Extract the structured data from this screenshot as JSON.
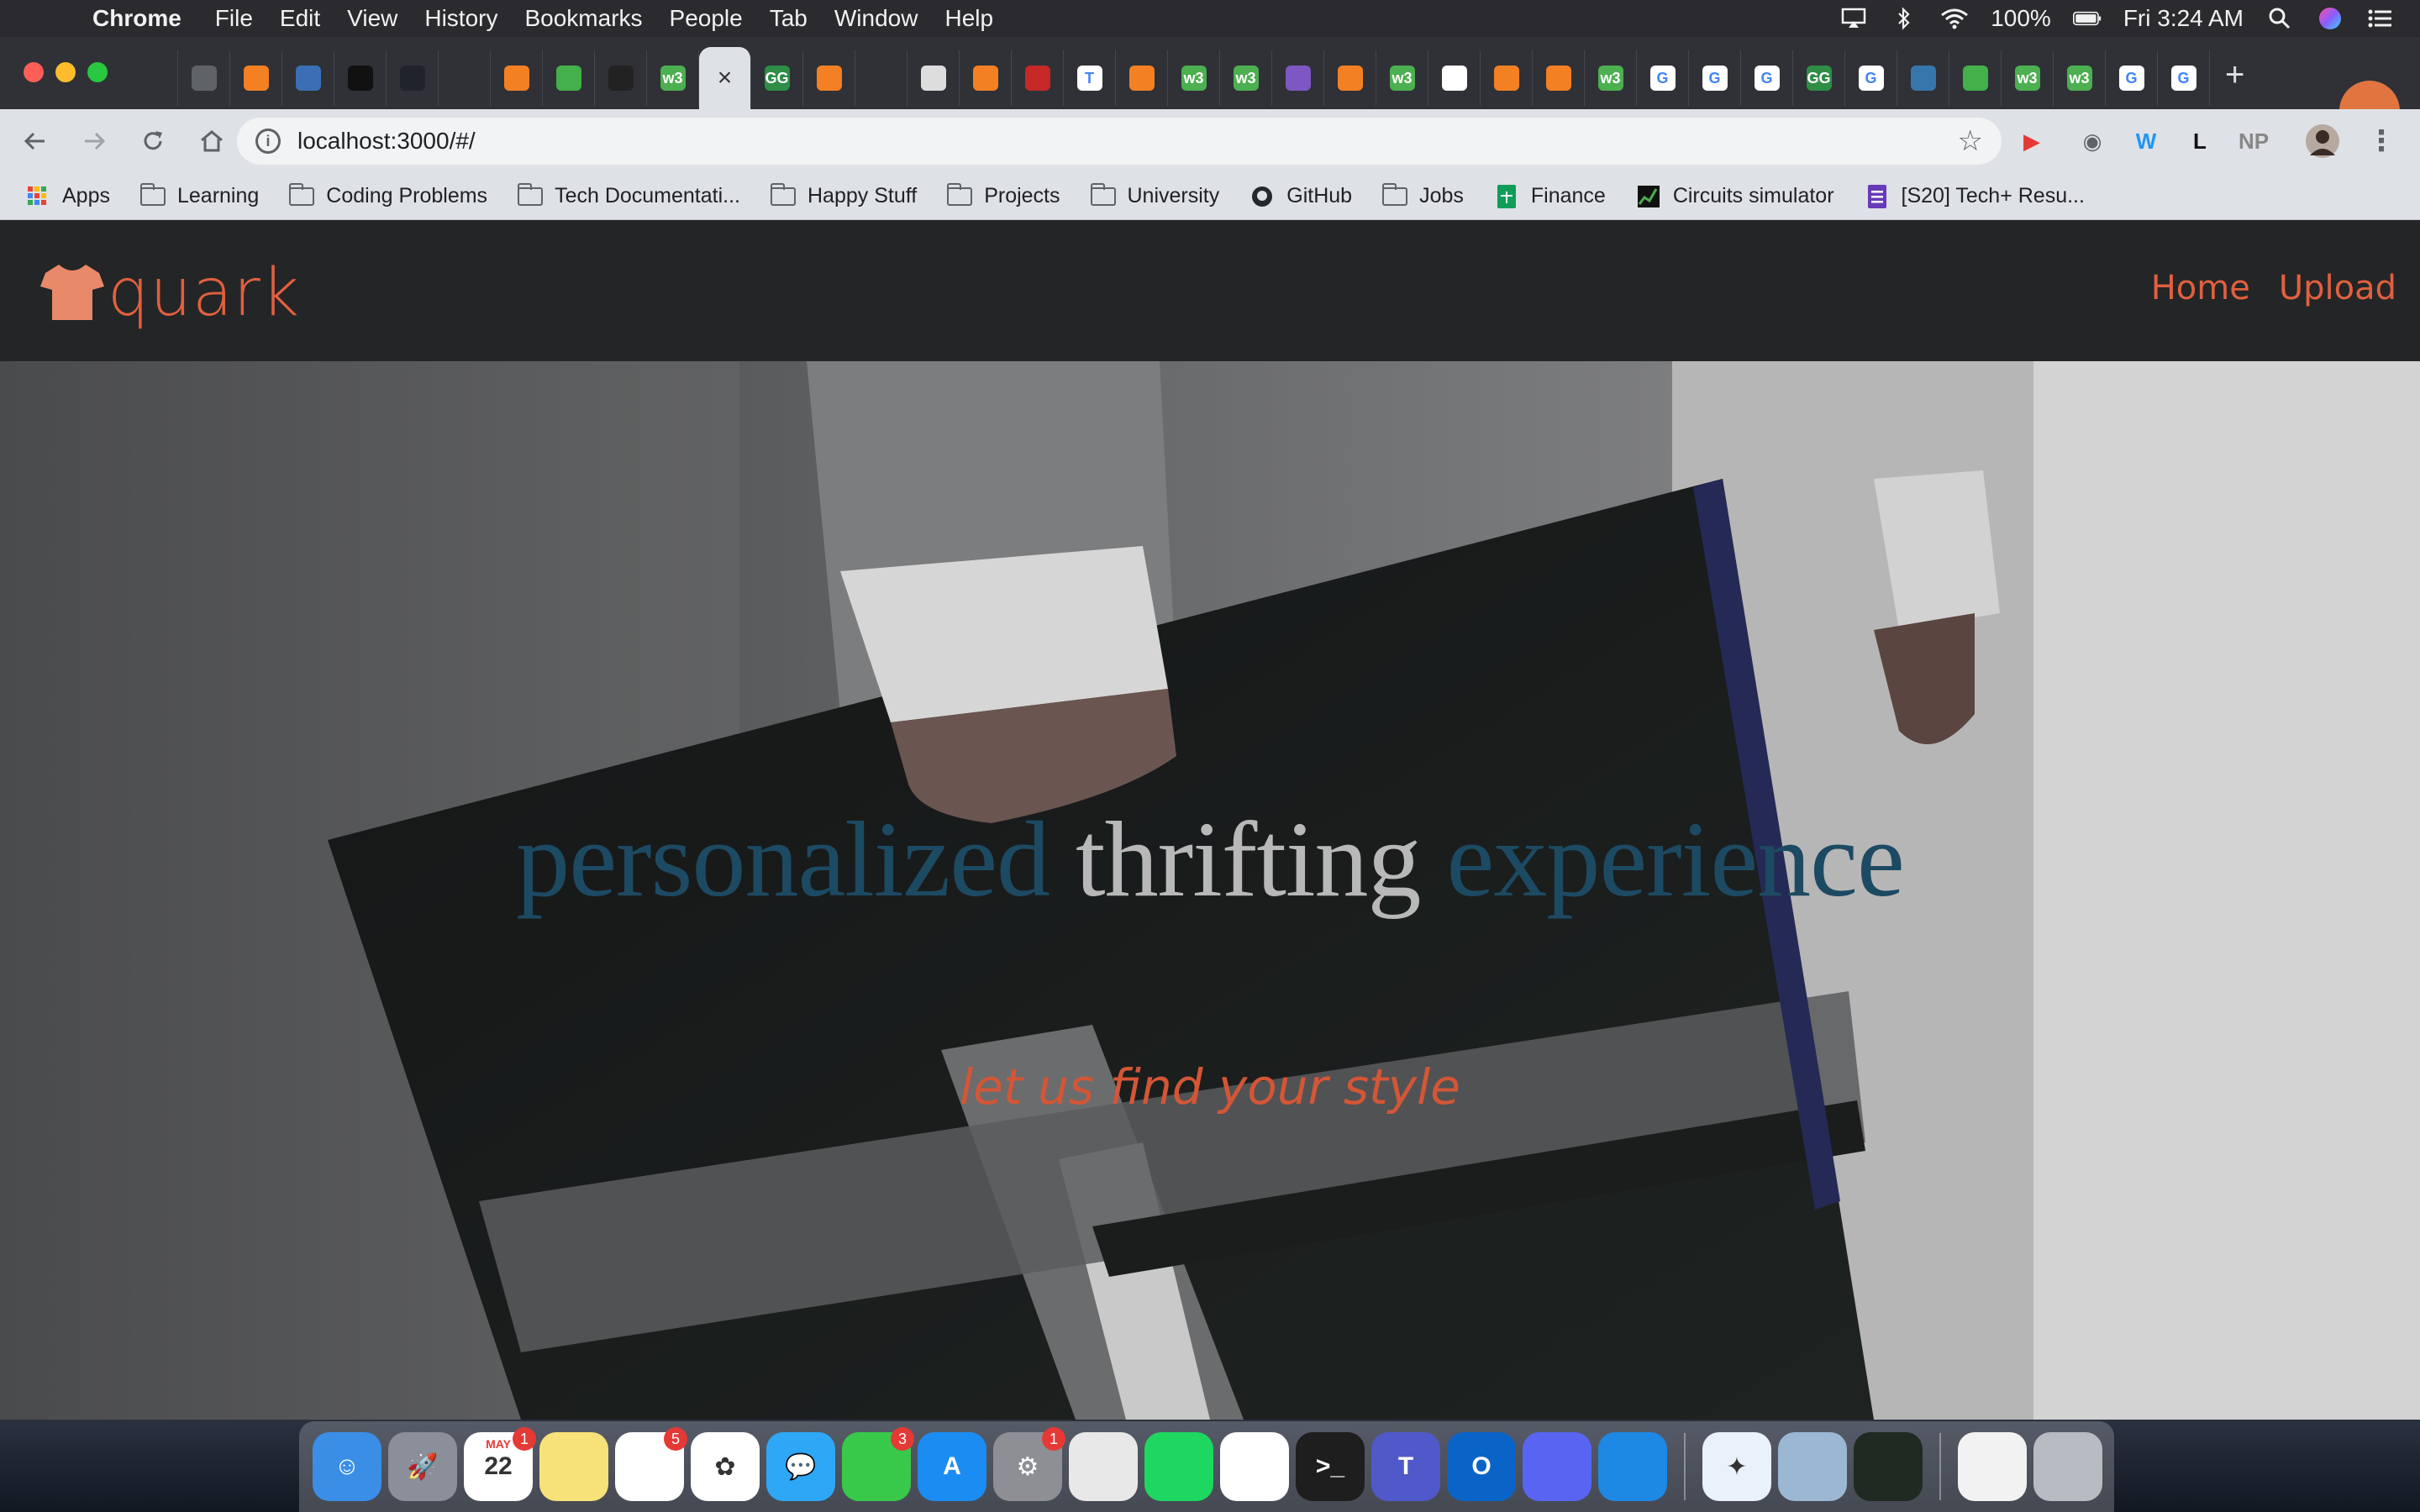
{
  "menubar": {
    "app_name": "Chrome",
    "menus": [
      "File",
      "Edit",
      "View",
      "History",
      "Bookmarks",
      "People",
      "Tab",
      "Window",
      "Help"
    ],
    "battery": "100%",
    "clock": "Fri 3:24 AM"
  },
  "tabs": [
    {
      "icon": "github-icon",
      "color": "#2f3136",
      "glyph": ""
    },
    {
      "icon": "globe-icon",
      "color": "#5f6368",
      "glyph": ""
    },
    {
      "icon": "stackoverflow-icon",
      "color": "#f48024",
      "glyph": ""
    },
    {
      "icon": "mathworks-icon",
      "color": "#3b6fb5",
      "glyph": ""
    },
    {
      "icon": "dots-icon",
      "color": "#111111",
      "glyph": ""
    },
    {
      "icon": "react-icon",
      "color": "#20232a",
      "glyph": ""
    },
    {
      "icon": "github-icon",
      "color": "#2f3136",
      "glyph": ""
    },
    {
      "icon": "stackoverflow-icon",
      "color": "#f48024",
      "glyph": ""
    },
    {
      "icon": "anaconda-icon",
      "color": "#43b049",
      "glyph": ""
    },
    {
      "icon": "s-icon",
      "color": "#222222",
      "glyph": ""
    },
    {
      "icon": "w3schools-icon",
      "color": "#4caf50",
      "glyph": "w3"
    },
    {
      "icon": "close-icon",
      "active": true,
      "glyph": "×"
    },
    {
      "icon": "geeksforgeeks-icon",
      "color": "#2f8d46",
      "glyph": "GG"
    },
    {
      "icon": "stackoverflow-icon",
      "color": "#f48024",
      "glyph": ""
    },
    {
      "icon": "github-icon",
      "color": "#2f3136",
      "glyph": ""
    },
    {
      "icon": "diamond-icon",
      "color": "#dddddd",
      "glyph": ""
    },
    {
      "icon": "stackoverflow-icon",
      "color": "#f48024",
      "glyph": ""
    },
    {
      "icon": "ball-icon",
      "color": "#c62828",
      "glyph": ""
    },
    {
      "icon": "t-icon",
      "color": "#ffffff",
      "glyph": "T"
    },
    {
      "icon": "stackoverflow-icon",
      "color": "#f48024",
      "glyph": ""
    },
    {
      "icon": "w3schools-icon",
      "color": "#4caf50",
      "glyph": "w3"
    },
    {
      "icon": "w3schools-icon",
      "color": "#4caf50",
      "glyph": "w3"
    },
    {
      "icon": "rocket-icon",
      "color": "#7e57c2",
      "glyph": ""
    },
    {
      "icon": "stackoverflow-icon",
      "color": "#f48024",
      "glyph": ""
    },
    {
      "icon": "w3schools-icon",
      "color": "#4caf50",
      "glyph": "w3"
    },
    {
      "icon": "python-icon",
      "color": "#ffffff",
      "glyph": ""
    },
    {
      "icon": "stackoverflow-icon",
      "color": "#f48024",
      "glyph": ""
    },
    {
      "icon": "stackoverflow-icon",
      "color": "#f48024",
      "glyph": ""
    },
    {
      "icon": "w3schools-icon",
      "color": "#4caf50",
      "glyph": "w3"
    },
    {
      "icon": "google-icon",
      "color": "#ffffff",
      "glyph": "G"
    },
    {
      "icon": "google-icon",
      "color": "#ffffff",
      "glyph": "G"
    },
    {
      "icon": "google-icon",
      "color": "#ffffff",
      "glyph": "G"
    },
    {
      "icon": "geeksforgeeks-icon",
      "color": "#2f8d46",
      "glyph": "GG"
    },
    {
      "icon": "google-icon",
      "color": "#ffffff",
      "glyph": "G"
    },
    {
      "icon": "python-icon",
      "color": "#3776ab",
      "glyph": ""
    },
    {
      "icon": "anaconda-icon",
      "color": "#43b049",
      "glyph": ""
    },
    {
      "icon": "w3schools-icon",
      "color": "#4caf50",
      "glyph": "w3"
    },
    {
      "icon": "w3schools-icon",
      "color": "#4caf50",
      "glyph": "w3"
    },
    {
      "icon": "google-icon",
      "color": "#ffffff",
      "glyph": "G"
    },
    {
      "icon": "google-icon",
      "color": "#ffffff",
      "glyph": "G"
    }
  ],
  "omnibox": {
    "url": "localhost:3000/#/"
  },
  "extensions": [
    {
      "icon": "youtube-icon",
      "color": "#e53935",
      "glyph": "▶"
    },
    {
      "icon": "eye-icon",
      "color": "#5f6368",
      "glyph": "◉"
    },
    {
      "icon": "w-icon",
      "color": "#2196f3",
      "glyph": "W"
    },
    {
      "icon": "l-icon",
      "color": "#111111",
      "glyph": "L"
    },
    {
      "icon": "np-icon",
      "color": "#888888",
      "glyph": "NP"
    }
  ],
  "bookmarks": [
    {
      "label": "Apps",
      "icon": "apps-grid-icon"
    },
    {
      "label": "Learning",
      "icon": "folder-icon"
    },
    {
      "label": "Coding Problems",
      "icon": "folder-icon"
    },
    {
      "label": "Tech Documentati...",
      "icon": "folder-icon"
    },
    {
      "label": "Happy Stuff",
      "icon": "folder-icon"
    },
    {
      "label": "Projects",
      "icon": "folder-icon"
    },
    {
      "label": "University",
      "icon": "folder-icon"
    },
    {
      "label": "GitHub",
      "icon": "github-icon"
    },
    {
      "label": "Jobs",
      "icon": "folder-icon"
    },
    {
      "label": "Finance",
      "icon": "sheets-icon"
    },
    {
      "label": "Circuits simulator",
      "icon": "circuit-icon"
    },
    {
      "label": "[S20] Tech+ Resu...",
      "icon": "forms-icon"
    }
  ],
  "site": {
    "brand": "quark",
    "nav": [
      "Home",
      "Upload"
    ],
    "headline": {
      "w1": "personalized",
      "w2": "thrifting",
      "w3": "experience"
    },
    "tagline": "let us find your style",
    "accent": "#e0603f"
  },
  "dock": [
    {
      "icon": "finder-icon",
      "color": "#3a8ee6",
      "glyph": "☺"
    },
    {
      "icon": "launchpad-icon",
      "color": "#8a8f99",
      "glyph": "🚀"
    },
    {
      "icon": "calendar-icon",
      "color": "#ffffff",
      "glyph": "22",
      "badge": "1",
      "sub": "MAY"
    },
    {
      "icon": "notes-icon",
      "color": "#f7e27a",
      "glyph": ""
    },
    {
      "icon": "reminders-icon",
      "color": "#ffffff",
      "glyph": "",
      "badge": "5"
    },
    {
      "icon": "photos-icon",
      "color": "#ffffff",
      "glyph": "✿"
    },
    {
      "icon": "messages-icon",
      "color": "#2ea7f7",
      "glyph": "💬"
    },
    {
      "icon": "facetime-icon",
      "color": "#38c94a",
      "glyph": "",
      "badge": "3"
    },
    {
      "icon": "appstore-icon",
      "color": "#1b8cf2",
      "glyph": "A"
    },
    {
      "icon": "system-preferences-icon",
      "color": "#8d8f94",
      "glyph": "⚙",
      "badge": "1"
    },
    {
      "icon": "chrome-icon",
      "color": "#e8e8e8",
      "glyph": ""
    },
    {
      "icon": "spotify-icon",
      "color": "#1ed760",
      "glyph": ""
    },
    {
      "icon": "slack-icon",
      "color": "#ffffff",
      "glyph": ""
    },
    {
      "icon": "terminal-icon",
      "color": "#1e1e1e",
      "glyph": ">_"
    },
    {
      "icon": "teams-icon",
      "color": "#5059c9",
      "glyph": "T"
    },
    {
      "icon": "outlook-icon",
      "color": "#0a64c8",
      "glyph": "O"
    },
    {
      "icon": "discord-icon",
      "color": "#5865f2",
      "glyph": ""
    },
    {
      "icon": "vscode-icon",
      "color": "#1e88e5",
      "glyph": ""
    },
    {
      "sep": true
    },
    {
      "icon": "safari-icon",
      "color": "#e9f1fb",
      "glyph": "✦"
    },
    {
      "icon": "preview-icon",
      "color": "#9bb7d4",
      "glyph": ""
    },
    {
      "icon": "activity-monitor-icon",
      "color": "#1f2a22",
      "glyph": ""
    },
    {
      "sep": true
    },
    {
      "icon": "zip-file-icon",
      "color": "#f2f2f2",
      "glyph": ""
    },
    {
      "icon": "trash-icon",
      "color": "#b7bcc2",
      "glyph": ""
    }
  ]
}
